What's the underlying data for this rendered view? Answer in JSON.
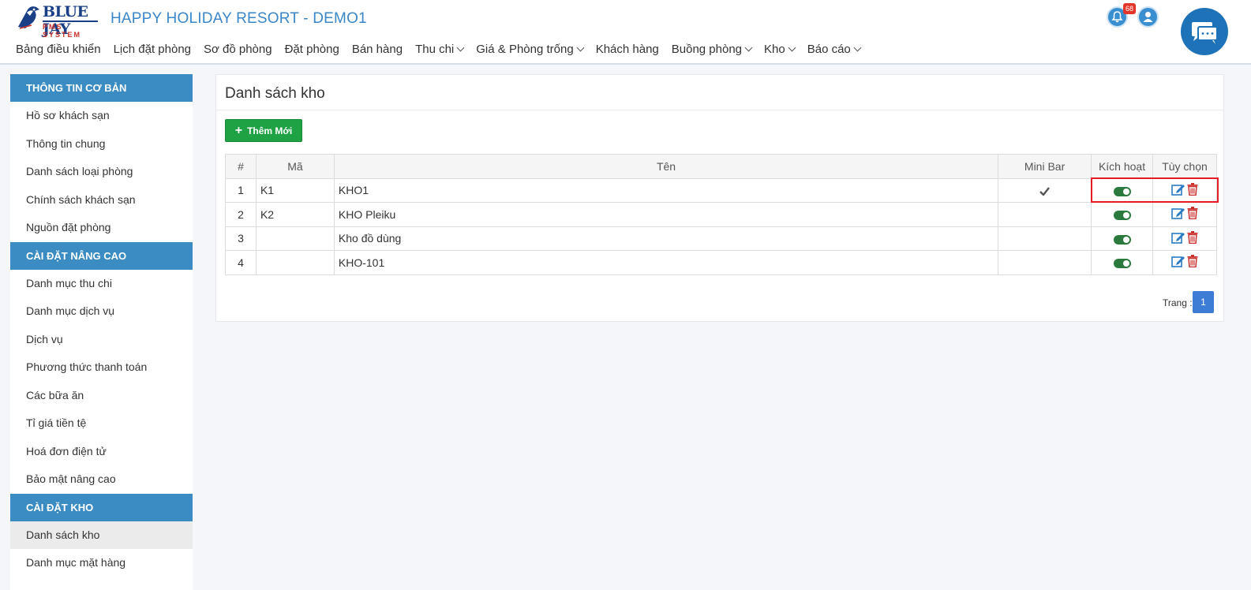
{
  "header": {
    "logo_text": "BLUE JAY",
    "logo_sub": "PMS SYSTEM",
    "app_title": "HAPPY HOLIDAY RESORT - DEMO1",
    "notification_count": "68",
    "nav": [
      {
        "label": "Bảng điều khiển",
        "dropdown": false
      },
      {
        "label": "Lịch đặt phòng",
        "dropdown": false
      },
      {
        "label": "Sơ đồ phòng",
        "dropdown": false
      },
      {
        "label": "Đặt phòng",
        "dropdown": false
      },
      {
        "label": "Bán hàng",
        "dropdown": false
      },
      {
        "label": "Thu chi",
        "dropdown": true
      },
      {
        "label": "Giá & Phòng trống",
        "dropdown": true
      },
      {
        "label": "Khách hàng",
        "dropdown": false
      },
      {
        "label": "Buồng phòng",
        "dropdown": true
      },
      {
        "label": "Kho",
        "dropdown": true
      },
      {
        "label": "Báo cáo",
        "dropdown": true
      }
    ]
  },
  "sidebar": {
    "sections": [
      {
        "title": "THÔNG TIN CƠ BẢN",
        "items": [
          "Hồ sơ khách sạn",
          "Thông tin chung",
          "Danh sách loại phòng",
          "Chính sách khách sạn",
          "Nguồn đặt phòng"
        ]
      },
      {
        "title": "CÀI ĐẶT NÂNG CAO",
        "items": [
          "Danh mục thu chi",
          "Danh mục dịch vụ",
          "Dịch vụ",
          "Phương thức thanh toán",
          "Các bữa ăn",
          "Tỉ giá tiền tệ",
          "Hoá đơn điện tử",
          "Bảo mật nâng cao"
        ]
      },
      {
        "title": "CÀI ĐẶT KHO",
        "items": [
          "Danh sách kho",
          "Danh mục mặt hàng"
        ]
      }
    ],
    "active_item": "Danh sách kho"
  },
  "main": {
    "title": "Danh sách kho",
    "add_button": "Thêm Mới",
    "columns": [
      "#",
      "Mã",
      "Tên",
      "Mini Bar",
      "Kích hoạt",
      "Tùy chọn"
    ],
    "rows": [
      {
        "no": "1",
        "code": "K1",
        "name": "KHO1",
        "minibar": true,
        "active": true
      },
      {
        "no": "2",
        "code": "K2",
        "name": "KHO Pleiku",
        "minibar": false,
        "active": true
      },
      {
        "no": "3",
        "code": "",
        "name": "Kho đồ dùng",
        "minibar": false,
        "active": true
      },
      {
        "no": "4",
        "code": "",
        "name": "KHO-101",
        "minibar": false,
        "active": true
      }
    ],
    "pager_label": "Trang :",
    "current_page": "1"
  },
  "colors": {
    "accent": "#3a8cc2",
    "add_button": "#1fa244",
    "toggle_on": "#2b7a3d",
    "edit_icon": "#2a7bc4",
    "delete_icon": "#c9302c",
    "highlight_box": "#e51c23"
  },
  "icons": {
    "check": "check-icon",
    "edit": "edit-icon",
    "delete": "trash-icon",
    "bell": "bell-icon",
    "user": "user-icon",
    "chat": "chat-icon"
  }
}
